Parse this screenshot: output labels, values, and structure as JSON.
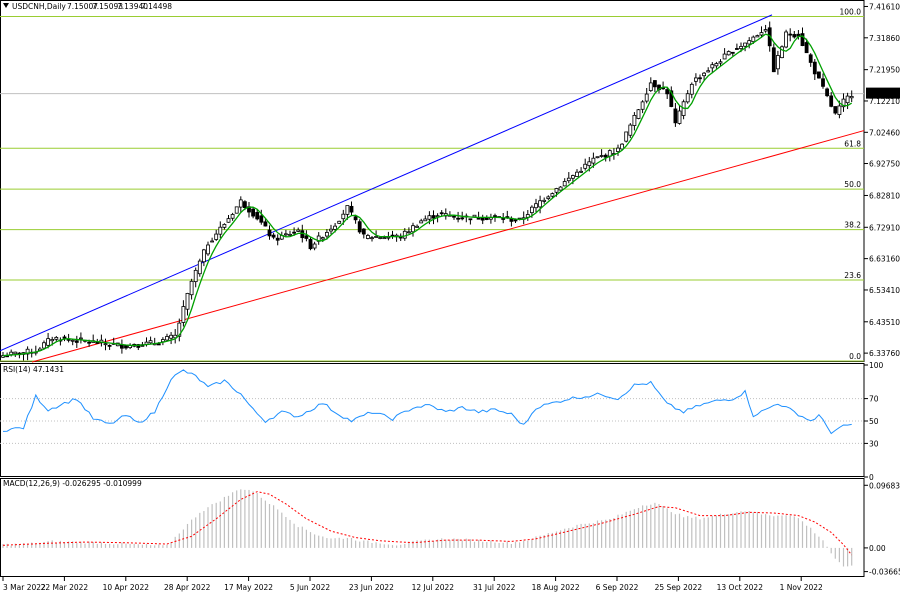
{
  "header": {
    "symbol": "USDCNH,Daily",
    "open": "7.15007",
    "high": "7.15093",
    "low": "7.13940",
    "close": "7.14498"
  },
  "rsi_label": "RSI(14) 47.1431",
  "macd_label": "MACD(12,26,9) -0.026295 -0.010999",
  "colors": {
    "up_candle_body": "#ffffff",
    "down_candle_body": "#000000",
    "ma_line": "#00a000",
    "upper_trendline": "#0000ff",
    "lower_trendline": "#ff0000",
    "fib_lines": "#9acd32",
    "rsi_line": "#1e90ff",
    "macd_signal": "#ff0000",
    "macd_hist": "#c0c0c0"
  },
  "chart_data": [
    {
      "type": "candlestick",
      "title": "USDCNH,Daily",
      "y_ticks": [
        "7.41610",
        "7.31860",
        "7.21950",
        "7.12210",
        "7.02460",
        "6.92750",
        "6.82810",
        "6.72910",
        "6.63160",
        "6.53410",
        "6.43510",
        "6.33760"
      ],
      "ylim": [
        6.31,
        7.43
      ],
      "current_price": "7.14498",
      "x_ticks": [
        "3 Mar 2022",
        "22 Mar 2022",
        "10 Apr 2022",
        "28 Apr 2022",
        "17 May 2022",
        "5 Jun 2022",
        "23 Jun 2022",
        "12 Jul 2022",
        "31 Jul 2022",
        "18 Aug 2022",
        "6 Sep 2022",
        "25 Sep 2022",
        "13 Oct 2022",
        "1 Nov 2022"
      ],
      "fibonacci": [
        {
          "level": "100.0",
          "price": 7.385
        },
        {
          "level": "61.8",
          "price": 6.975
        },
        {
          "level": "50.0",
          "price": 6.848
        },
        {
          "level": "38.2",
          "price": 6.722
        },
        {
          "level": "23.6",
          "price": 6.565
        },
        {
          "level": "0.0",
          "price": 6.313
        }
      ],
      "trendlines": [
        {
          "name": "upper",
          "from": [
            "3 Mar 2022",
            6.345
          ],
          "to": [
            "25 Oct 2022",
            7.39
          ]
        },
        {
          "name": "lower",
          "from": [
            "10 Mar 2022",
            6.31
          ],
          "to": [
            "12 Nov 2022",
            7.03
          ]
        }
      ],
      "close_anchors": [
        [
          0,
          6.33
        ],
        [
          8,
          6.345
        ],
        [
          12,
          6.385
        ],
        [
          20,
          6.375
        ],
        [
          30,
          6.36
        ],
        [
          37,
          6.37
        ],
        [
          42,
          6.39
        ],
        [
          46,
          6.56
        ],
        [
          50,
          6.68
        ],
        [
          54,
          6.74
        ],
        [
          58,
          6.81
        ],
        [
          62,
          6.76
        ],
        [
          66,
          6.69
        ],
        [
          72,
          6.72
        ],
        [
          75,
          6.67
        ],
        [
          81,
          6.74
        ],
        [
          84,
          6.79
        ],
        [
          88,
          6.7
        ],
        [
          97,
          6.7
        ],
        [
          102,
          6.75
        ],
        [
          106,
          6.77
        ],
        [
          112,
          6.76
        ],
        [
          120,
          6.76
        ],
        [
          126,
          6.75
        ],
        [
          131,
          6.81
        ],
        [
          138,
          6.88
        ],
        [
          144,
          6.94
        ],
        [
          150,
          6.97
        ],
        [
          154,
          7.07
        ],
        [
          158,
          7.18
        ],
        [
          162,
          7.15
        ],
        [
          164,
          7.05
        ],
        [
          168,
          7.18
        ],
        [
          174,
          7.24
        ],
        [
          178,
          7.28
        ],
        [
          182,
          7.31
        ],
        [
          186,
          7.35
        ],
        [
          188,
          7.22
        ],
        [
          191,
          7.33
        ],
        [
          194,
          7.33
        ],
        [
          197,
          7.24
        ],
        [
          200,
          7.16
        ],
        [
          203,
          7.08
        ],
        [
          205,
          7.12
        ],
        [
          207,
          7.145
        ]
      ]
    },
    {
      "type": "line",
      "title": "RSI(14) 47.1431",
      "y_ticks": [
        "100",
        "70",
        "50",
        "30",
        "0"
      ],
      "ylim": [
        0,
        100
      ],
      "levels": [
        70,
        50,
        30
      ],
      "anchors": [
        [
          0,
          42
        ],
        [
          5,
          44
        ],
        [
          8,
          72
        ],
        [
          11,
          60
        ],
        [
          15,
          66
        ],
        [
          18,
          70
        ],
        [
          22,
          52
        ],
        [
          26,
          47
        ],
        [
          30,
          55
        ],
        [
          33,
          48
        ],
        [
          37,
          58
        ],
        [
          41,
          88
        ],
        [
          44,
          95
        ],
        [
          47,
          90
        ],
        [
          50,
          80
        ],
        [
          54,
          86
        ],
        [
          58,
          74
        ],
        [
          61,
          60
        ],
        [
          64,
          50
        ],
        [
          68,
          58
        ],
        [
          72,
          54
        ],
        [
          76,
          62
        ],
        [
          78,
          66
        ],
        [
          81,
          58
        ],
        [
          85,
          50
        ],
        [
          90,
          58
        ],
        [
          95,
          52
        ],
        [
          100,
          62
        ],
        [
          104,
          64
        ],
        [
          108,
          58
        ],
        [
          112,
          62
        ],
        [
          116,
          58
        ],
        [
          120,
          60
        ],
        [
          124,
          56
        ],
        [
          127,
          46
        ],
        [
          130,
          62
        ],
        [
          134,
          66
        ],
        [
          138,
          70
        ],
        [
          142,
          72
        ],
        [
          146,
          74
        ],
        [
          150,
          70
        ],
        [
          154,
          82
        ],
        [
          158,
          84
        ],
        [
          162,
          65
        ],
        [
          166,
          58
        ],
        [
          170,
          64
        ],
        [
          174,
          68
        ],
        [
          178,
          70
        ],
        [
          181,
          76
        ],
        [
          183,
          55
        ],
        [
          186,
          60
        ],
        [
          189,
          66
        ],
        [
          193,
          58
        ],
        [
          197,
          50
        ],
        [
          199,
          55
        ],
        [
          202,
          40
        ],
        [
          205,
          45
        ],
        [
          207,
          47
        ]
      ]
    },
    {
      "type": "bar",
      "title": "MACD(12,26,9) -0.026295 -0.010999",
      "y_ticks": [
        "0.096831",
        "0.00",
        "-0.03665"
      ],
      "ylim": [
        -0.045,
        0.105
      ],
      "hist_anchors": [
        [
          0,
          0.005
        ],
        [
          6,
          0.006
        ],
        [
          12,
          0.01
        ],
        [
          18,
          0.009
        ],
        [
          24,
          0.008
        ],
        [
          30,
          0.006
        ],
        [
          36,
          0.004
        ],
        [
          40,
          0.003
        ],
        [
          44,
          0.03
        ],
        [
          48,
          0.055
        ],
        [
          52,
          0.07
        ],
        [
          56,
          0.085
        ],
        [
          58,
          0.092
        ],
        [
          61,
          0.088
        ],
        [
          64,
          0.074
        ],
        [
          68,
          0.055
        ],
        [
          72,
          0.034
        ],
        [
          76,
          0.022
        ],
        [
          80,
          0.014
        ],
        [
          84,
          0.016
        ],
        [
          88,
          0.01
        ],
        [
          92,
          0.008
        ],
        [
          96,
          0.005
        ],
        [
          100,
          0.009
        ],
        [
          104,
          0.012
        ],
        [
          108,
          0.014
        ],
        [
          112,
          0.013
        ],
        [
          116,
          0.011
        ],
        [
          120,
          0.01
        ],
        [
          124,
          0.008
        ],
        [
          128,
          0.012
        ],
        [
          132,
          0.02
        ],
        [
          136,
          0.028
        ],
        [
          140,
          0.035
        ],
        [
          144,
          0.04
        ],
        [
          148,
          0.044
        ],
        [
          152,
          0.055
        ],
        [
          156,
          0.066
        ],
        [
          159,
          0.07
        ],
        [
          162,
          0.06
        ],
        [
          166,
          0.048
        ],
        [
          170,
          0.046
        ],
        [
          174,
          0.05
        ],
        [
          178,
          0.055
        ],
        [
          182,
          0.058
        ],
        [
          185,
          0.052
        ],
        [
          188,
          0.05
        ],
        [
          191,
          0.052
        ],
        [
          194,
          0.046
        ],
        [
          197,
          0.03
        ],
        [
          200,
          0.012
        ],
        [
          203,
          -0.018
        ],
        [
          205,
          -0.03
        ],
        [
          207,
          -0.026
        ]
      ],
      "signal_anchors": [
        [
          0,
          0.004
        ],
        [
          10,
          0.007
        ],
        [
          20,
          0.009
        ],
        [
          30,
          0.008
        ],
        [
          40,
          0.006
        ],
        [
          46,
          0.018
        ],
        [
          52,
          0.045
        ],
        [
          58,
          0.075
        ],
        [
          62,
          0.087
        ],
        [
          65,
          0.083
        ],
        [
          69,
          0.068
        ],
        [
          74,
          0.045
        ],
        [
          80,
          0.026
        ],
        [
          86,
          0.016
        ],
        [
          92,
          0.011
        ],
        [
          100,
          0.008
        ],
        [
          108,
          0.012
        ],
        [
          116,
          0.012
        ],
        [
          124,
          0.01
        ],
        [
          130,
          0.014
        ],
        [
          138,
          0.026
        ],
        [
          146,
          0.038
        ],
        [
          154,
          0.052
        ],
        [
          160,
          0.064
        ],
        [
          164,
          0.062
        ],
        [
          170,
          0.05
        ],
        [
          176,
          0.05
        ],
        [
          182,
          0.055
        ],
        [
          188,
          0.054
        ],
        [
          194,
          0.05
        ],
        [
          198,
          0.04
        ],
        [
          202,
          0.024
        ],
        [
          205,
          0.005
        ],
        [
          207,
          -0.011
        ]
      ]
    }
  ]
}
